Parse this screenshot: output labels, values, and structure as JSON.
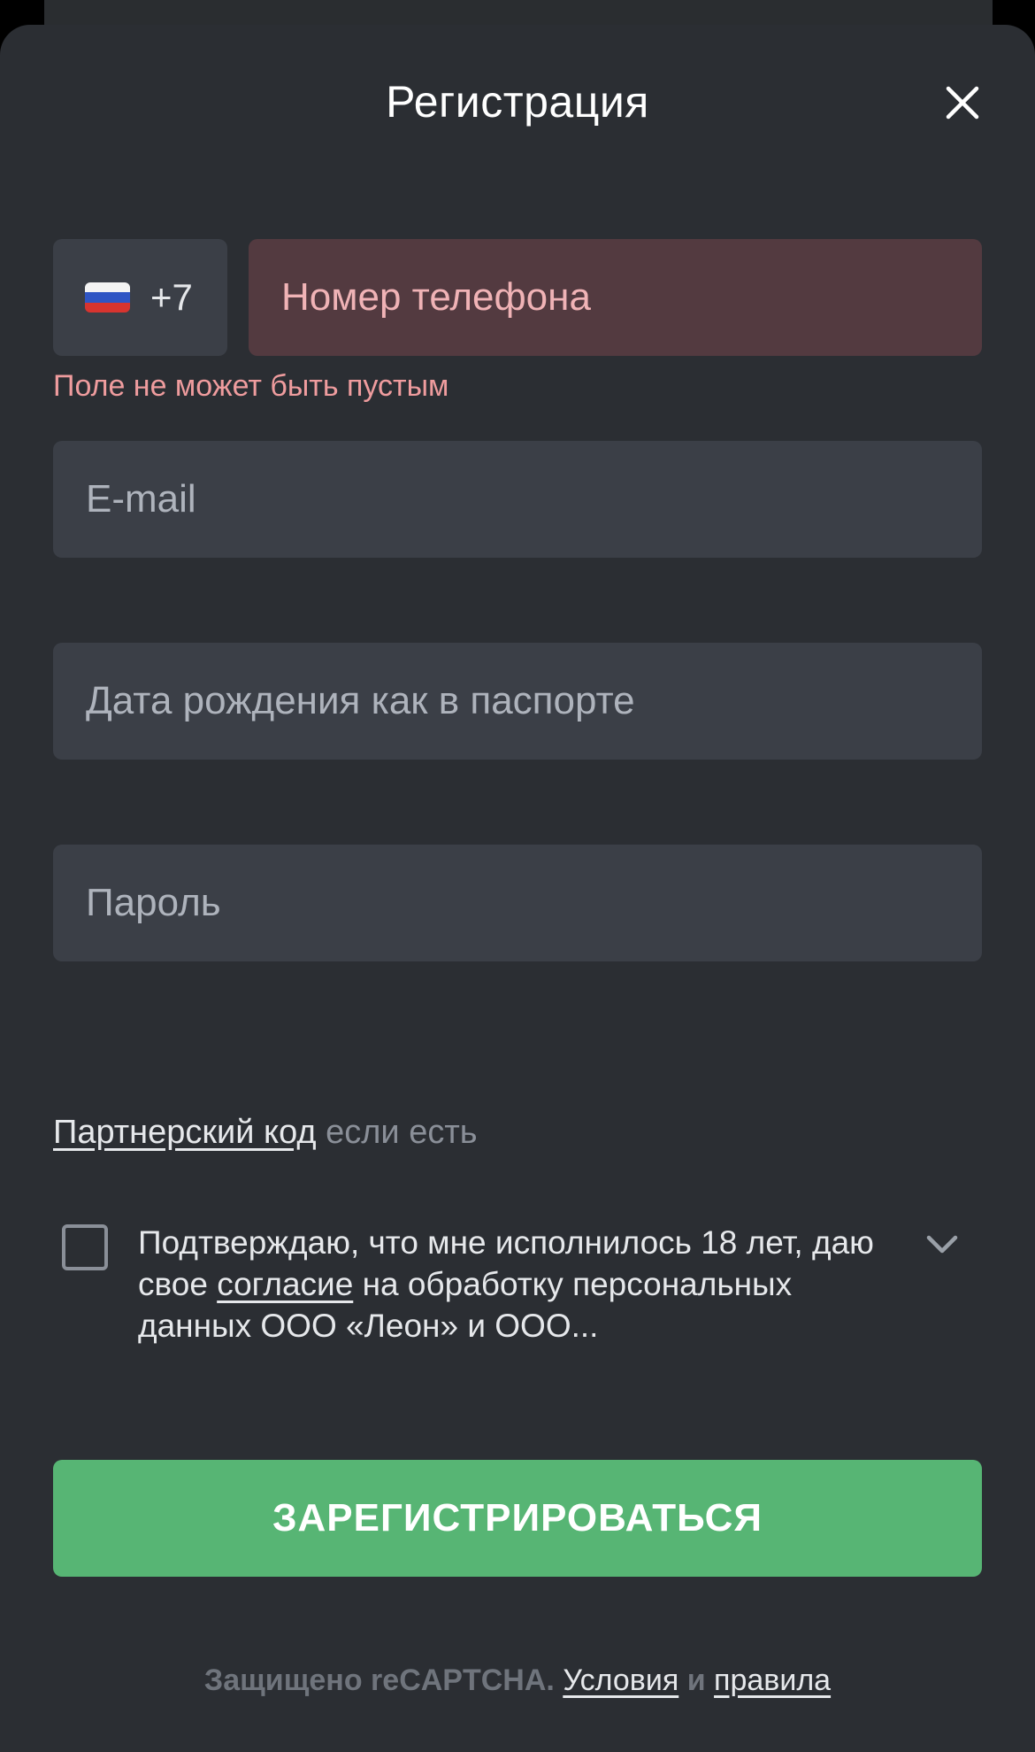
{
  "title": "Регистрация",
  "phone": {
    "country_flag": "flag-russia-icon",
    "dial_code": "+7",
    "placeholder": "Номер телефона",
    "error": "Поле не может быть пустым"
  },
  "email": {
    "placeholder": "E-mail"
  },
  "birthdate": {
    "placeholder": "Дата рождения как в паспорте"
  },
  "password": {
    "placeholder": "Пароль"
  },
  "partner": {
    "link": "Партнерский код",
    "hint": "если есть"
  },
  "consent": {
    "text_before": "Подтверждаю, что мне исполнилось 18 лет, даю свое",
    "link": "согласие",
    "text_after": "на обработку персональных данных ООО «Леон» и ООО...",
    "checked": false
  },
  "submit_label": "ЗАРЕГИСТРИРОВАТЬСЯ",
  "footer": {
    "protected": "Защищено reCAPTCHA.",
    "terms_link": "Условия",
    "and": "и",
    "rules_link": "правила"
  },
  "colors": {
    "background": "#2b2e33",
    "field": "#3b3f47",
    "error_field": "#533a40",
    "error_text": "#ef9c9e",
    "accent": "#57b574"
  }
}
